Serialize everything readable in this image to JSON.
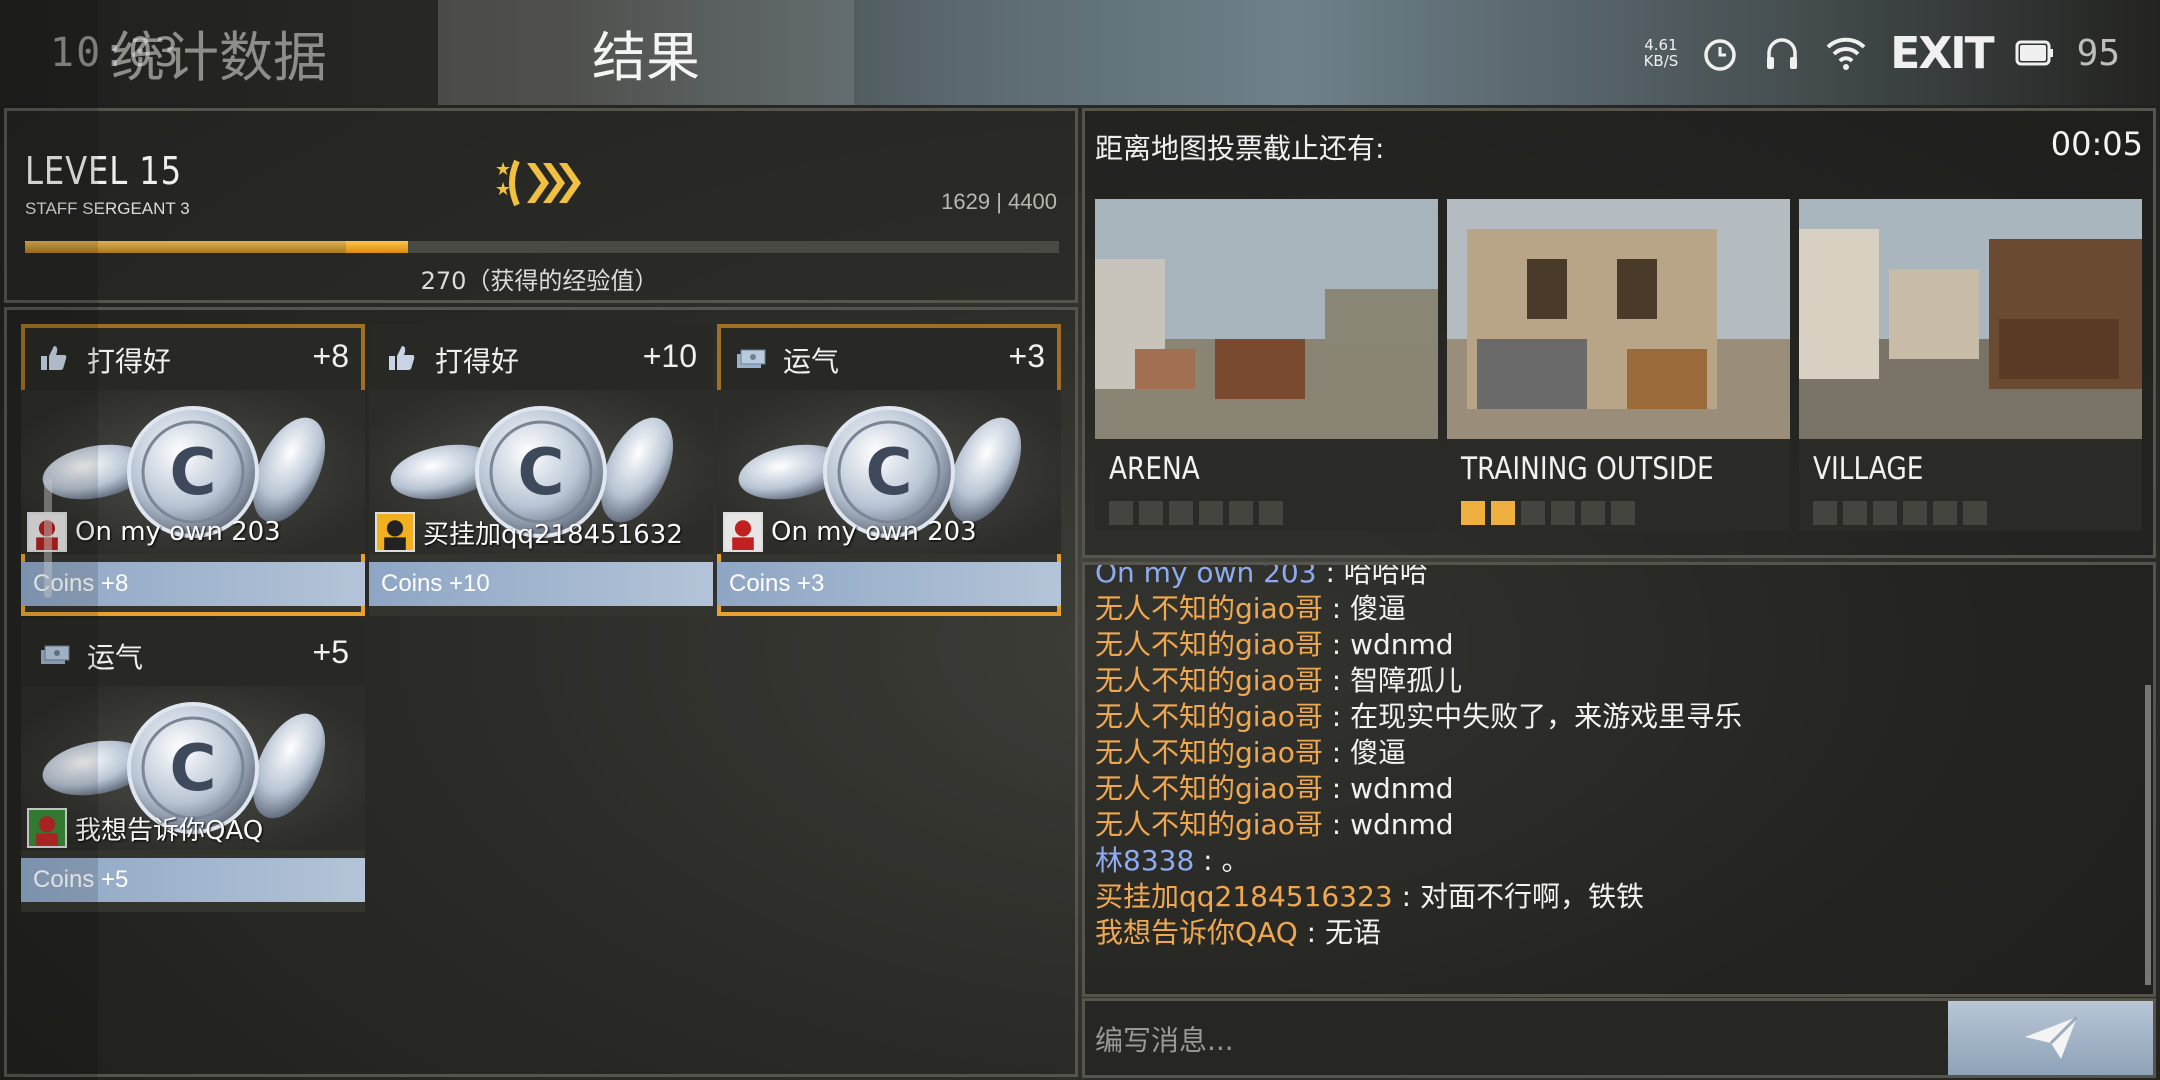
{
  "status_bar": {
    "time": "10:03",
    "net_speed_top": "4.61",
    "net_speed_unit": "KB/S",
    "battery": "95"
  },
  "tabs": {
    "stats": "统计数据",
    "results": "结果"
  },
  "exit_label": "EXIT",
  "player": {
    "level": "LEVEL 15",
    "rank": "STAFF SERGEANT 3",
    "xp_current": "1629 | 4400",
    "xp_gain": "270（获得的经验值）",
    "xp_progress_old": 0.31,
    "xp_progress_new": 0.37
  },
  "rewards": [
    {
      "title": "打得好",
      "plus": "+8",
      "player": "On my own 203",
      "coins": "Coins +8",
      "icon": "thumbs-up-icon",
      "highlight": true
    },
    {
      "title": "打得好",
      "plus": "+10",
      "player": "买挂加qq218451632",
      "coins": "Coins +10",
      "icon": "thumbs-up-icon",
      "highlight": false
    },
    {
      "title": "运气",
      "plus": "+3",
      "player": "On my own 203",
      "coins": "Coins +3",
      "icon": "cash-icon",
      "highlight": true
    },
    {
      "title": "运气",
      "plus": "+5",
      "player": "我想告诉你QAQ",
      "coins": "Coins +5",
      "icon": "cash-icon",
      "highlight": false
    }
  ],
  "vote": {
    "title": "距离地图投票截止还有:",
    "timer": "00:05",
    "maps": [
      {
        "name": "ARENA",
        "votes": 0
      },
      {
        "name": "TRAINING OUTSIDE",
        "votes": 2
      },
      {
        "name": "VILLAGE",
        "votes": 0
      }
    ],
    "max_votes": 6
  },
  "chat": {
    "messages": [
      {
        "sender": "On my own 203",
        "text": "哈哈哈",
        "color": "blue"
      },
      {
        "sender": "无人不知的giao哥",
        "text": "傻逼",
        "color": "orange"
      },
      {
        "sender": "无人不知的giao哥",
        "text": "wdnmd",
        "color": "orange"
      },
      {
        "sender": "无人不知的giao哥",
        "text": "智障孤儿",
        "color": "orange"
      },
      {
        "sender": "无人不知的giao哥",
        "text": "在现实中失败了，来游戏里寻乐",
        "color": "orange"
      },
      {
        "sender": "无人不知的giao哥",
        "text": "傻逼",
        "color": "orange"
      },
      {
        "sender": "无人不知的giao哥",
        "text": "wdnmd",
        "color": "orange"
      },
      {
        "sender": "无人不知的giao哥",
        "text": "wdnmd",
        "color": "orange"
      },
      {
        "sender": "林8338",
        "text": "。",
        "color": "blue"
      },
      {
        "sender": "买挂加qq2184516323",
        "text": "对面不行啊，铁铁",
        "color": "orange"
      },
      {
        "sender": "我想告诉你QAQ",
        "text": "无语",
        "color": "orange"
      }
    ],
    "separator": " : ",
    "input_placeholder": "编写消息..."
  }
}
